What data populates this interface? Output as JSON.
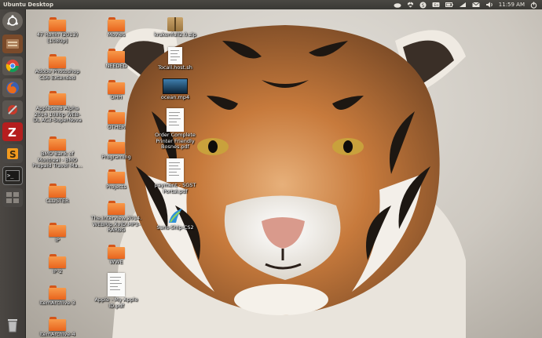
{
  "panel": {
    "title": "Ubuntu Desktop",
    "clock": "11:59 AM",
    "indicators": [
      "cloud-icon",
      "dropbox-icon",
      "skype-icon",
      "keyboard-icon",
      "battery-icon",
      "wifi-icon",
      "mail-icon",
      "volume-icon",
      "power-icon"
    ]
  },
  "launcher": {
    "items": [
      {
        "name": "dash-home-icon"
      },
      {
        "name": "files-icon"
      },
      {
        "name": "chrome-icon"
      },
      {
        "name": "firefox-icon"
      },
      {
        "name": "settings-icon"
      },
      {
        "name": "filezilla-icon"
      },
      {
        "name": "sublime-icon"
      },
      {
        "name": "terminal-icon"
      },
      {
        "name": "workspaces-icon"
      },
      {
        "name": "trash-icon"
      }
    ]
  },
  "desktop": {
    "col1": [
      {
        "type": "folder",
        "label": "47 Ronin (2013) [1080p]"
      },
      {
        "type": "folder",
        "label": "Adobe Photoshop CS6 Extended"
      },
      {
        "type": "folder",
        "label": "Appleseed Alpha 2014 1080p WEB-DL AC3-SuperNova"
      },
      {
        "type": "folder",
        "label": "BMO Bank of Montreal - BMO Prepaid Travel Ma..."
      },
      {
        "type": "folder",
        "label": "CLUSTER"
      },
      {
        "type": "folder",
        "label": "IP"
      },
      {
        "type": "folder",
        "label": "IP-2"
      },
      {
        "type": "folder",
        "label": "ItemArchive-3"
      },
      {
        "type": "folder",
        "label": "ItemArchive-4"
      }
    ],
    "col2": [
      {
        "type": "folder",
        "label": "Movies"
      },
      {
        "type": "folder",
        "label": "NEEDED"
      },
      {
        "type": "folder",
        "label": "OHH"
      },
      {
        "type": "folder",
        "label": "OTHER"
      },
      {
        "type": "folder",
        "label": "Programing"
      },
      {
        "type": "folder",
        "label": "Projects"
      },
      {
        "type": "folder",
        "label": "The.Interview.2014.WEBRip.XviD.MP3-RARBG"
      },
      {
        "type": "folder",
        "label": "WWE"
      },
      {
        "type": "doc",
        "label": "Apple - My Apple ID.pdf"
      }
    ],
    "col3": [
      {
        "type": "zip",
        "label": "krakenfull2.0.zip"
      },
      {
        "type": "text",
        "label": "Tocall.host.sh"
      },
      {
        "type": "video",
        "label": "ocean.mp4"
      },
      {
        "type": "doc",
        "label": "Order Complete Printer Friendly Bosnes.pdf"
      },
      {
        "type": "doc",
        "label": "payment - SGST Portal.pdf"
      },
      {
        "type": "image",
        "label": "Sans-Ship-CS2"
      }
    ]
  },
  "colors": {
    "panel": "#3c3b37",
    "folder": "#f0731f"
  }
}
